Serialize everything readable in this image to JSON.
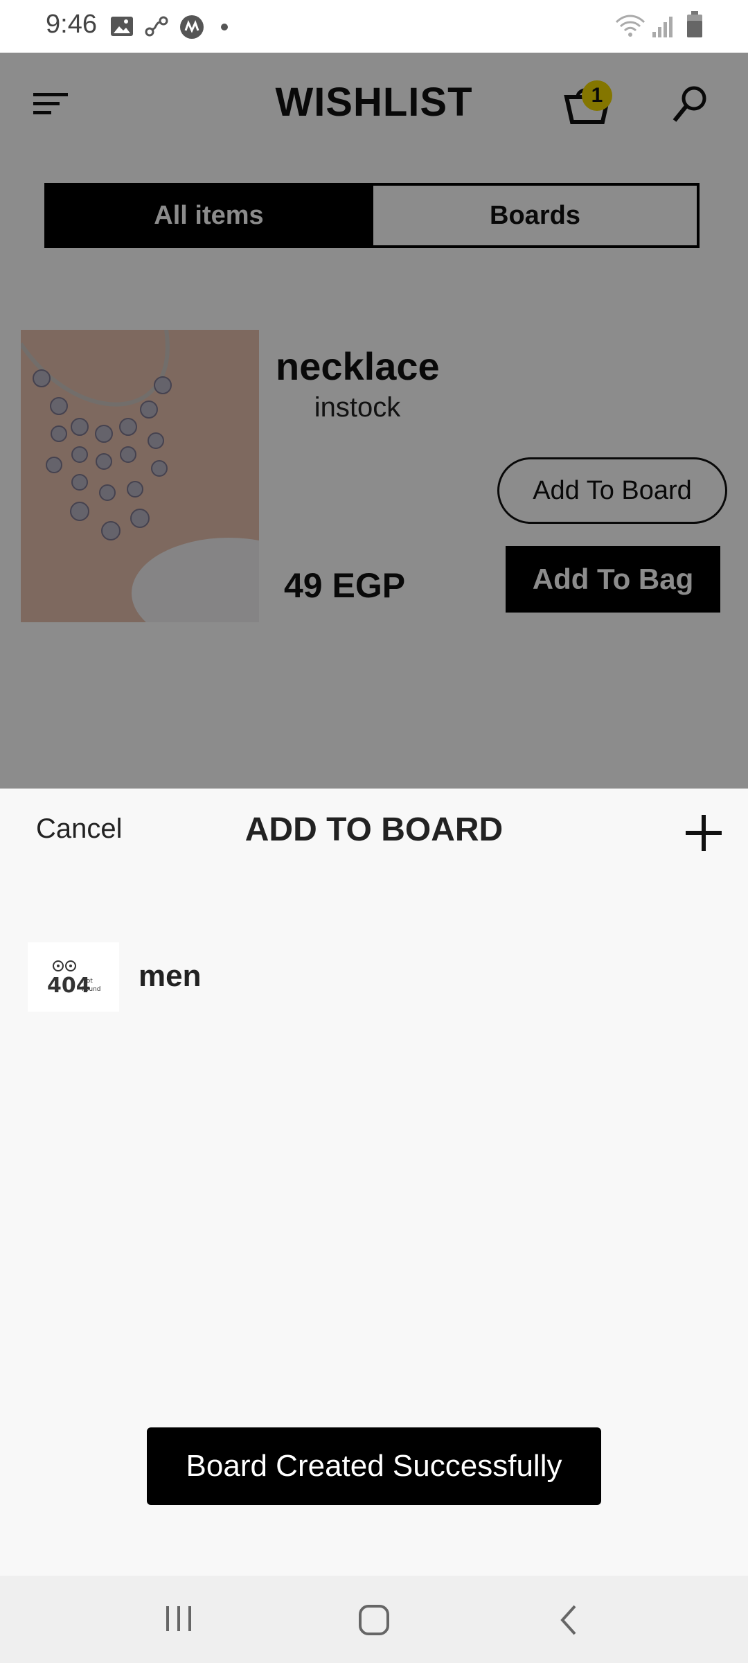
{
  "status_bar": {
    "time": "9:46",
    "icons": [
      "gallery-icon",
      "link-icon",
      "app-icon",
      "dot-icon",
      "wifi-icon",
      "signal-icon",
      "battery-icon"
    ]
  },
  "header": {
    "title": "WISHLIST",
    "cart_count": "1",
    "icons": [
      "menu-icon",
      "bag-icon",
      "search-icon"
    ]
  },
  "tabs": [
    {
      "label": "All items",
      "active": true
    },
    {
      "label": "Boards",
      "active": false
    }
  ],
  "product": {
    "name": "necklace",
    "stock": "instock",
    "price": "49 EGP",
    "add_to_board_label": "Add To Board",
    "add_to_bag_label": "Add To Bag"
  },
  "sheet": {
    "cancel_label": "Cancel",
    "title": "ADD TO BOARD",
    "boards": [
      {
        "name": "men",
        "thumb_text_main": "404",
        "thumb_text_side1": "Not",
        "thumb_text_side2": "Found"
      }
    ]
  },
  "toast": {
    "message": "Board Created Successfully"
  },
  "nav": {
    "icons": [
      "recent-apps-icon",
      "home-icon",
      "back-icon"
    ]
  },
  "colors": {
    "badge": "#f1d800",
    "overlay": "rgba(0,0,0,0.45)",
    "primary": "#000000",
    "sheet_bg": "#f8f8f8"
  }
}
